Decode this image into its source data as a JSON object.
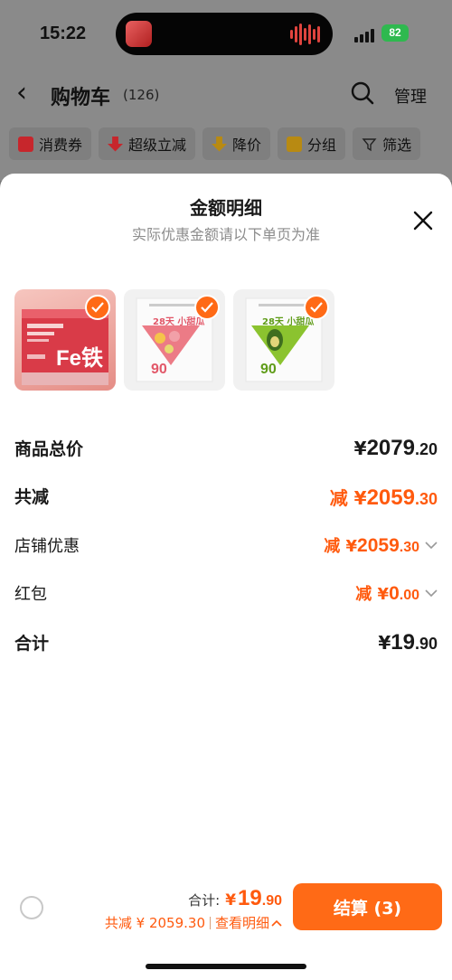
{
  "status_bar": {
    "time": "15:22",
    "battery": "82"
  },
  "nav": {
    "title": "购物车",
    "count": "(126)",
    "manage": "管理"
  },
  "filters": [
    {
      "label": "消费券"
    },
    {
      "label": "超级立减"
    },
    {
      "label": "降价"
    },
    {
      "label": "分组"
    },
    {
      "label": "筛选"
    }
  ],
  "sheet": {
    "title": "金额明细",
    "subtitle": "实际优惠金额请以下单页为准",
    "products": [
      {
        "brand_text": "Fe铁"
      },
      {
        "brand_text": "28天 小甜瓜",
        "count": "90"
      },
      {
        "brand_text": "28天 小甜瓜",
        "count": "90"
      }
    ],
    "rows": {
      "goods_total": {
        "label": "商品总价",
        "prefix": "¥",
        "main": "2079",
        "dec": ".20"
      },
      "total_reduce": {
        "label": "共减",
        "prefix": "减 ¥",
        "main": "2059",
        "dec": ".30"
      },
      "store_discount": {
        "label": "店铺优惠",
        "prefix": "减 ¥",
        "main": "2059",
        "dec": ".30"
      },
      "red_packet": {
        "label": "红包",
        "prefix": "减 ¥",
        "main": "0",
        "dec": ".00"
      },
      "sum": {
        "label": "合计",
        "prefix": "¥",
        "main": "19",
        "dec": ".90"
      }
    }
  },
  "bottom_bar": {
    "total_label": "合计:",
    "total_yen": "¥",
    "total_main": "19",
    "total_dec": ".90",
    "saved_text": "共减 ¥ 2059.30",
    "detail_link": "查看明细",
    "checkout_label": "结算 (3)"
  },
  "colors": {
    "accent": "#ff6a16",
    "discount": "#ff5a0e"
  }
}
